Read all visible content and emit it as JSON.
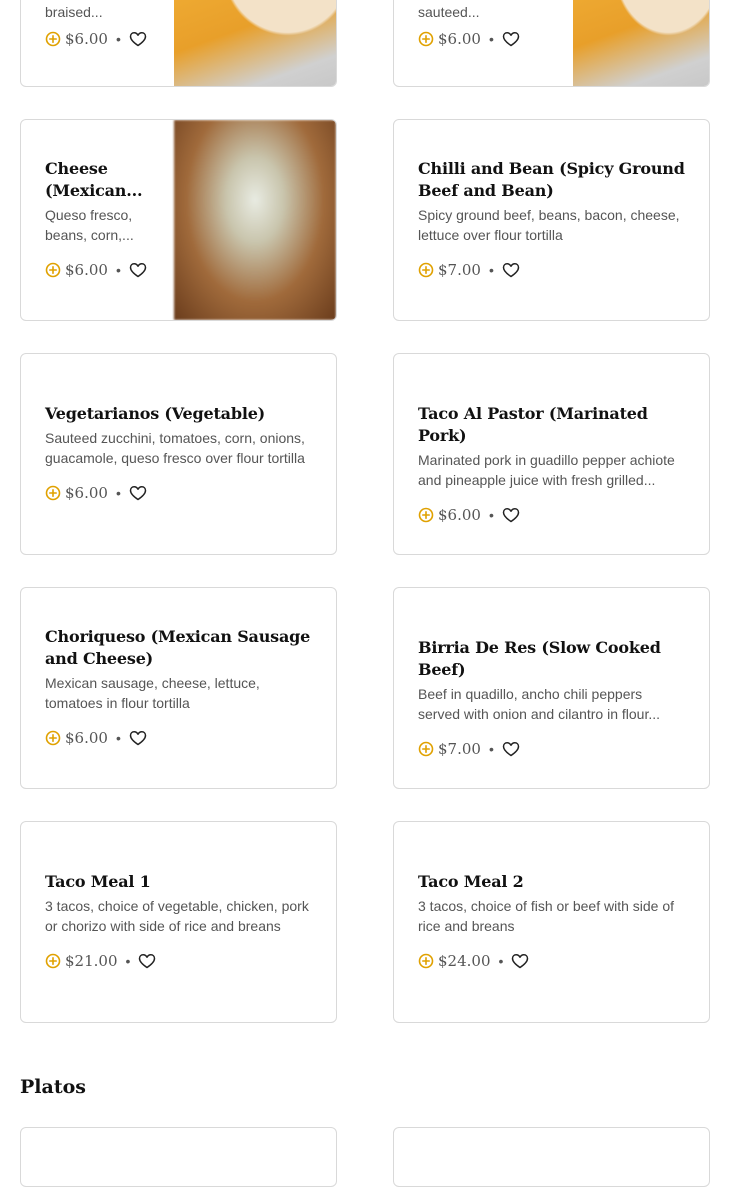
{
  "colors": {
    "accent": "#e0a100",
    "border": "#d9d9d9",
    "text_muted": "#555555"
  },
  "icons": {
    "add": "plus-circle-icon",
    "favorite": "heart-outline-icon"
  },
  "items": [
    {
      "desc": "braised...",
      "price": "$6.00"
    },
    {
      "desc": "sauteed...",
      "price": "$6.00"
    },
    {
      "title": "Cheese (Mexican...",
      "desc": "Queso fresco, beans, corn,...",
      "price": "$6.00"
    },
    {
      "title": "Chilli and Bean (Spicy Ground Beef and Bean)",
      "desc": "Spicy ground beef, beans, bacon, cheese, lettuce over flour tortilla",
      "price": "$7.00"
    },
    {
      "title": "Vegetarianos (Vegetable)",
      "desc": "Sauteed zucchini, tomatoes, corn, onions, guacamole, queso fresco over flour tortilla",
      "price": "$6.00"
    },
    {
      "title": "Taco Al Pastor (Marinated Pork)",
      "desc": "Marinated pork in guadillo pepper achiote and pineapple juice with fresh grilled...",
      "price": "$6.00"
    },
    {
      "title": "Choriqueso (Mexican Sausage and Cheese)",
      "desc": "Mexican sausage, cheese, lettuce, tomatoes in flour tortilla",
      "price": "$6.00"
    },
    {
      "title": "Birria De Res (Slow Cooked Beef)",
      "desc": "Beef in quadillo, ancho chili peppers served with onion and cilantro in flour...",
      "price": "$7.00"
    },
    {
      "title": "Taco Meal 1",
      "desc": "3 tacos, choice of vegetable, chicken, pork or chorizo with side of rice and breans",
      "price": "$21.00"
    },
    {
      "title": "Taco Meal 2",
      "desc": "3 tacos, choice of fish or beef with side of rice and breans",
      "price": "$24.00"
    }
  ],
  "sections": {
    "platos": "Platos"
  },
  "dot": "•"
}
